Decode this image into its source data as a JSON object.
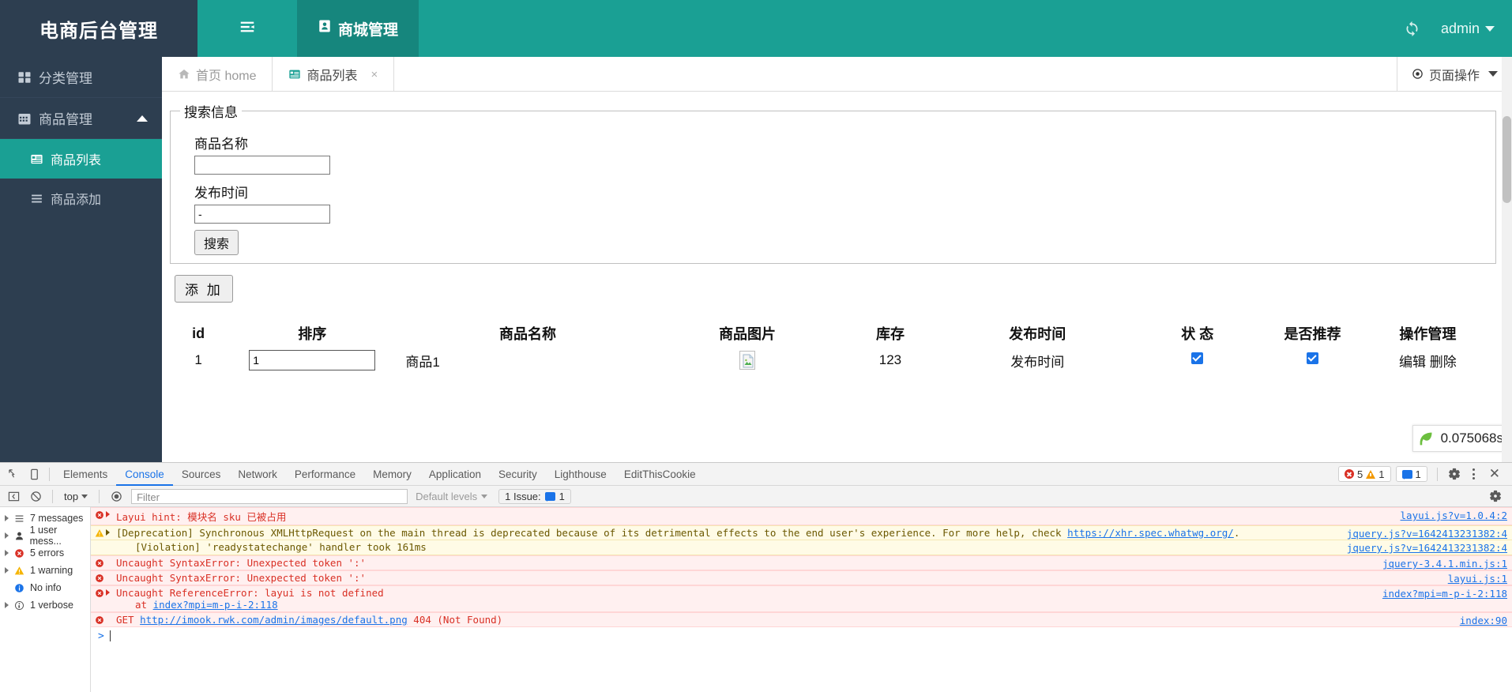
{
  "app": {
    "logo_title": "电商后台管理",
    "nav_tab_label": "商城管理",
    "admin_label": "admin"
  },
  "sidebar": {
    "items": [
      {
        "label": "分类管理",
        "icon": "grid-icon"
      },
      {
        "label": "商品管理",
        "icon": "calendar-icon"
      }
    ],
    "sub_items": [
      {
        "label": "商品列表",
        "icon": "list-icon",
        "active": true
      },
      {
        "label": "商品添加",
        "icon": "menu-icon",
        "active": false
      }
    ]
  },
  "content_tabs": {
    "items": [
      {
        "label": "首页 home",
        "icon": "home-icon",
        "active": false,
        "closable": false
      },
      {
        "label": "商品列表",
        "icon": "list-icon",
        "active": true,
        "closable": true
      }
    ],
    "close_glyph": "×",
    "page_ops_label": "页面操作"
  },
  "search": {
    "legend": "搜索信息",
    "name_label": "商品名称",
    "name_value": "",
    "name_placeholder": "",
    "time_label": "发布时间",
    "time_value": "-",
    "time_placeholder": "",
    "search_button": "搜索"
  },
  "toolbar": {
    "add_button": "添 加"
  },
  "table": {
    "headers": [
      "id",
      "排序",
      "商品名称",
      "商品图片",
      "库存",
      "发布时间",
      "状 态",
      "是否推荐",
      "操作管理"
    ],
    "rows": [
      {
        "id": "1",
        "sort_value": "1",
        "name": "商品1",
        "image": "broken-image-icon",
        "stock": "123",
        "publish_time": "发布时间",
        "status_checked": true,
        "recommend_checked": true,
        "edit_label": "编辑",
        "delete_label": "删除"
      }
    ]
  },
  "timing_badge": {
    "value": "0.075068s",
    "icon": "leaf-icon"
  },
  "devtools": {
    "tabs": [
      {
        "label": "Elements",
        "active": false
      },
      {
        "label": "Console",
        "active": true
      },
      {
        "label": "Sources",
        "active": false
      },
      {
        "label": "Network",
        "active": false
      },
      {
        "label": "Performance",
        "active": false
      },
      {
        "label": "Memory",
        "active": false
      },
      {
        "label": "Application",
        "active": false
      },
      {
        "label": "Security",
        "active": false
      },
      {
        "label": "Lighthouse",
        "active": false
      },
      {
        "label": "EditThisCookie",
        "active": false
      }
    ],
    "counts": {
      "errors": "5",
      "warnings": "1",
      "messages": "1"
    },
    "console_toolbar": {
      "context": "top",
      "filter_placeholder": "Filter",
      "filter_value": "",
      "levels_label": "Default levels",
      "issue_label": "1 Issue:",
      "issue_count": "1"
    },
    "sidepane": [
      {
        "label": "7 messages",
        "icon": "list-icon"
      },
      {
        "label": "1 user mess...",
        "icon": "user-icon"
      },
      {
        "label": "5 errors",
        "icon": "error-icon"
      },
      {
        "label": "1 warning",
        "icon": "warning-icon"
      },
      {
        "label": "No info",
        "icon": "info-icon"
      },
      {
        "label": "1 verbose",
        "icon": "verbose-icon"
      }
    ],
    "messages": [
      {
        "level": "error",
        "expandable": true,
        "text": "Layui hint: 模块名 sku 已被占用",
        "source": "layui.js?v=1.0.4:2"
      },
      {
        "level": "warning",
        "expandable": true,
        "text": "[Deprecation] Synchronous XMLHttpRequest on the main thread is deprecated because of its detrimental effects to the end user's experience. For more help, check ",
        "link_text": "https://xhr.spec.whatwg.org/",
        "text_after": ".",
        "source": "jquery.js?v=1642413231382:4"
      },
      {
        "level": "warning",
        "expandable": false,
        "indent": true,
        "text": "[Violation] 'readystatechange' handler took 161ms",
        "source": "jquery.js?v=1642413231382:4"
      },
      {
        "level": "error",
        "expandable": false,
        "text": "Uncaught SyntaxError: Unexpected token ':'",
        "source": "jquery-3.4.1.min.js:1"
      },
      {
        "level": "error",
        "expandable": false,
        "text": "Uncaught SyntaxError: Unexpected token ':'",
        "source": "layui.js:1"
      },
      {
        "level": "error",
        "expandable": true,
        "text": "Uncaught ReferenceError: layui is not defined",
        "sub_prefix": "at ",
        "sub_link": "index?mpi=m-p-i-2:118",
        "source": "index?mpi=m-p-i-2:118"
      },
      {
        "level": "error",
        "expandable": false,
        "prefix": "GET ",
        "link_text": "http://imook.rwk.com/admin/images/default.png",
        "text_after": " 404 (Not Found)",
        "source": "index:90"
      }
    ],
    "prompt_glyph": ">"
  },
  "colors": {
    "brand_teal": "#1aa094",
    "brand_teal_dark": "#16867d",
    "sidebar_navy": "#2d3e50",
    "checkbox_blue": "#1a73e8",
    "error_red": "#d93025",
    "warning_amber": "#f29900"
  }
}
